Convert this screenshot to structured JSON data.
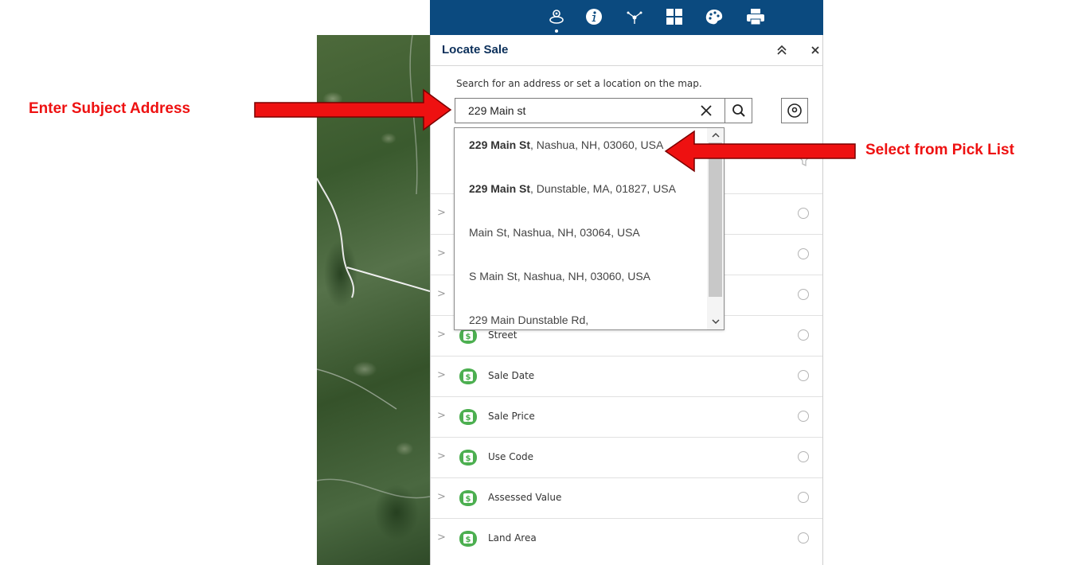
{
  "annotations": {
    "enter_subject_address": "Enter Subject Address",
    "select_from_pick_list": "Select from Pick List",
    "color": "#ee1111"
  },
  "toolbar": {
    "background": "#0b4a7f",
    "icons": [
      "layers-icon",
      "info-icon",
      "network-icon",
      "grid-icon",
      "palette-icon",
      "print-icon"
    ],
    "active_index": 0
  },
  "panel": {
    "title": "Locate Sale",
    "collapse_icon": "double-chevron-up-icon",
    "close_icon": "close-icon",
    "instruction": "Search for an address or set a location on the map."
  },
  "search": {
    "value": "229 Main st",
    "placeholder": "",
    "clear_icon": "close-icon",
    "search_icon": "search-icon",
    "locate_icon": "map-pin-icon"
  },
  "suggestions": [
    {
      "bold": "229 Main St",
      "rest": ", Nashua, NH, 03060, USA"
    },
    {
      "bold": "229 Main St",
      "rest": ", Dunstable, MA, 01827, USA"
    },
    {
      "bold": "",
      "rest": "Main St, Nashua, NH, 03064, USA"
    },
    {
      "bold": "",
      "rest": "S Main St, Nashua, NH, 03060, USA"
    },
    {
      "bold": "",
      "rest": "229 Main Dunstable Rd,"
    }
  ],
  "rows": [
    {
      "label": ""
    },
    {
      "label": ""
    },
    {
      "label": ""
    },
    {
      "label": "Street"
    },
    {
      "label": "Sale Date"
    },
    {
      "label": "Sale Price"
    },
    {
      "label": "Use Code"
    },
    {
      "label": "Assessed Value"
    },
    {
      "label": "Land Area"
    }
  ],
  "colors": {
    "badge_green": "#4caf50",
    "title_navy": "#0b2f5a"
  }
}
